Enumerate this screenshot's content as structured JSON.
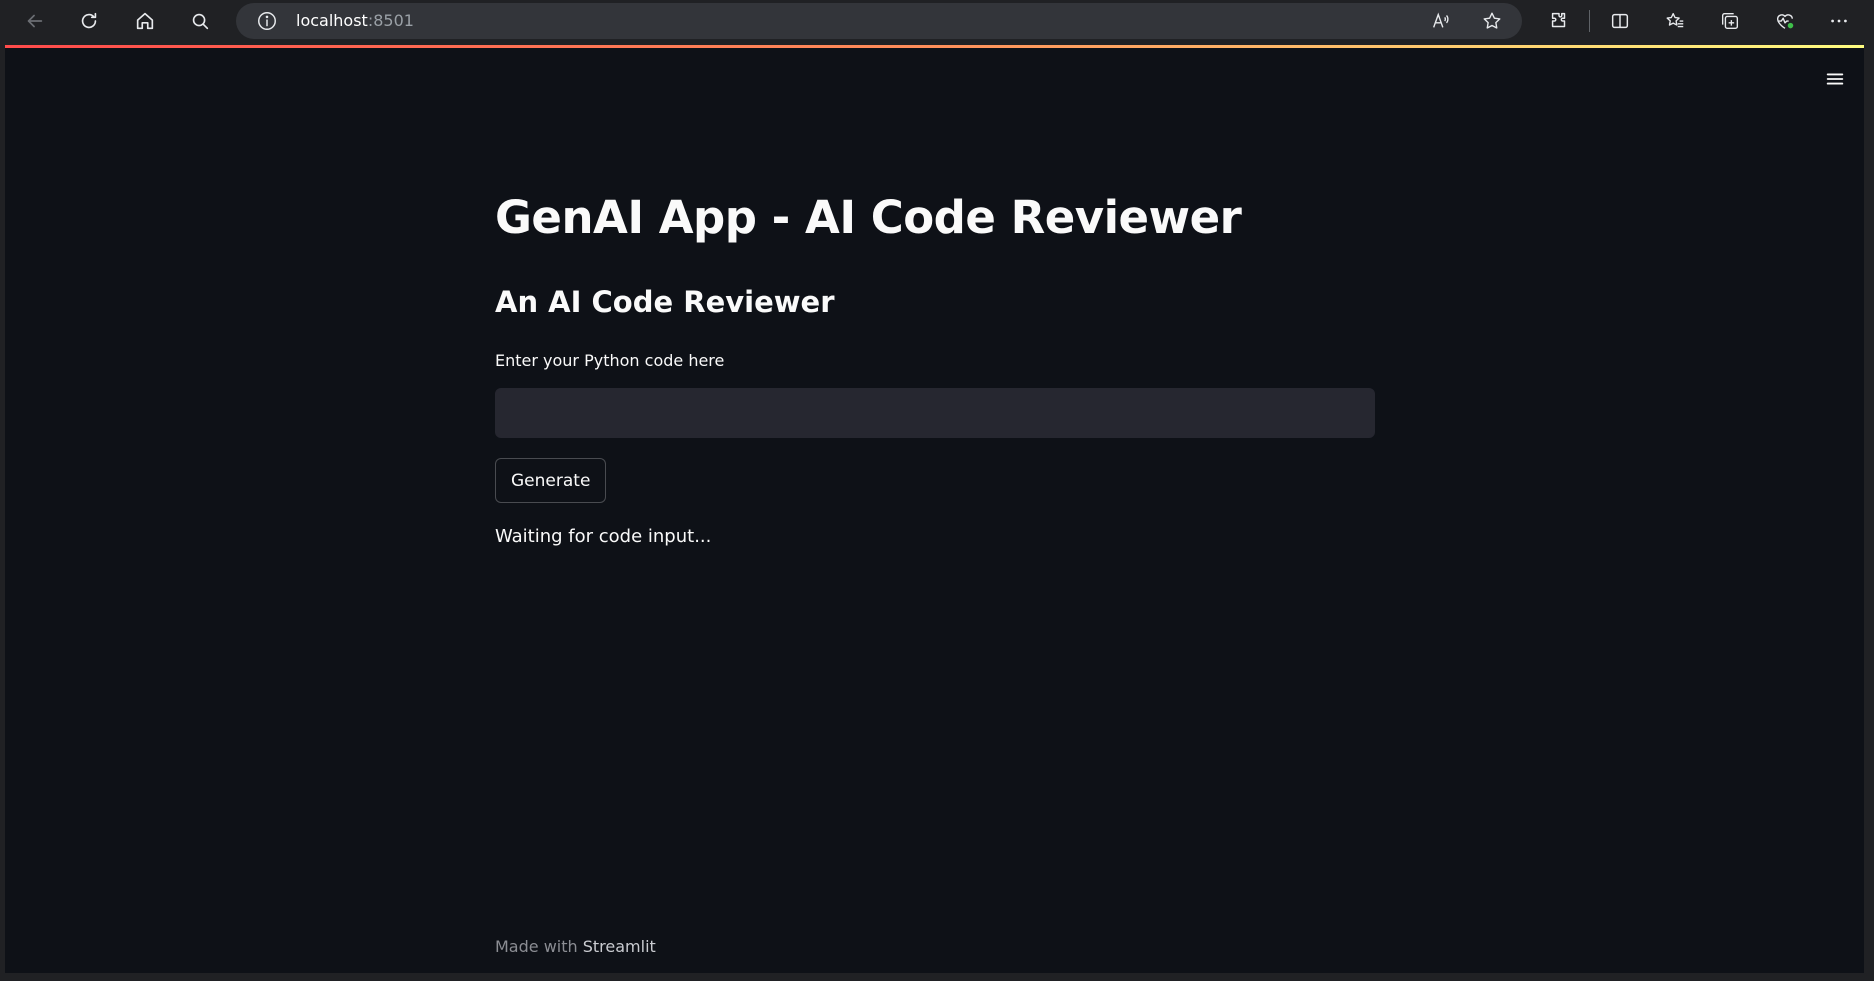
{
  "browser": {
    "url_host": "localhost",
    "url_port": ":8501",
    "icons": {
      "back": "back-arrow-icon",
      "reload": "reload-icon",
      "home": "home-icon",
      "search": "search-icon",
      "site_info": "info-icon",
      "read_aloud": "read-aloud-icon",
      "favorite": "star-icon",
      "extensions": "puzzle-icon",
      "split_screen": "split-screen-icon",
      "favorites": "favorites-list-icon",
      "collections": "collections-icon",
      "health": "heart-pulse-icon",
      "more": "more-dots-icon"
    }
  },
  "app": {
    "title": "GenAI App - AI Code Reviewer",
    "subtitle": "An AI Code Reviewer",
    "input_label": "Enter your Python code here",
    "input_value": "",
    "generate_label": "Generate",
    "status": "Waiting for code input...",
    "menu_icon": "hamburger-menu-icon",
    "footer": {
      "prefix": "Made with",
      "link": "Streamlit"
    }
  },
  "colors": {
    "background": "#0e1117",
    "input_background": "#262730",
    "text": "#fafafa",
    "accent_gradient": [
      "#ff4b4b",
      "#fffd80"
    ]
  }
}
